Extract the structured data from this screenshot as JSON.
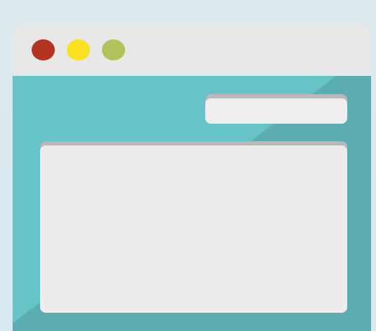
{
  "window": {
    "controls": {
      "close_color": "#b23421",
      "minimize_color": "#fde120",
      "maximize_color": "#b1c45c"
    },
    "titlebar_color": "#e8e8e8",
    "content_color": "#66c4c7"
  },
  "search": {
    "value": "",
    "placeholder": ""
  },
  "main_panel": {
    "text": ""
  }
}
